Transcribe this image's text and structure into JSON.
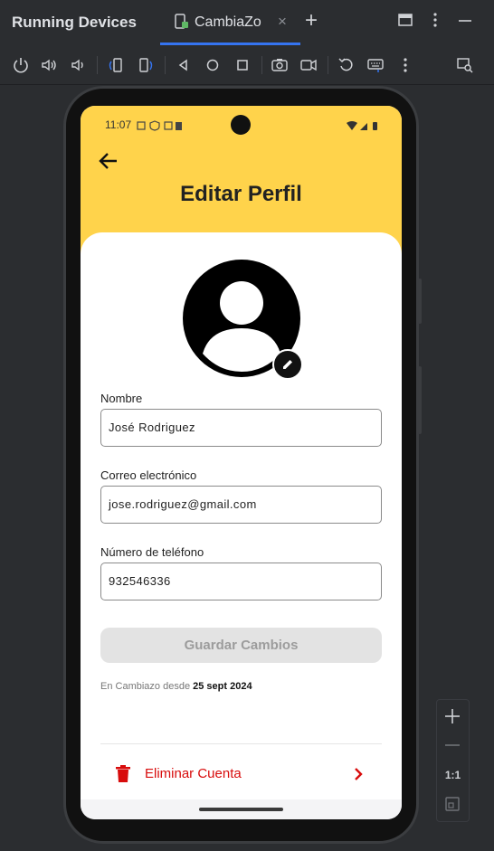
{
  "ide": {
    "panel_title": "Running Devices",
    "tab_label": "CambiaZo",
    "tab_close": "×",
    "add_tab": "+",
    "zoom_ratio": "1:1",
    "accent_color": "#3574f0"
  },
  "toolbar": {
    "icons": [
      "power-icon",
      "volume-up-icon",
      "volume-down-icon",
      "rotate-left-icon",
      "rotate-right-icon",
      "back-icon",
      "home-icon",
      "overview-icon",
      "screenshot-icon",
      "screen-record-icon",
      "reset-icon",
      "keyboard-icon",
      "more-icon",
      "device-explorer-icon"
    ]
  },
  "app": {
    "status_time": "11:07",
    "title": "Editar Perfil",
    "header_color": "#ffd34b",
    "fields": {
      "name_label": "Nombre",
      "name_value": "José Rodriguez",
      "email_label": "Correo electrónico",
      "email_value": "jose.rodriguez@gmail.com",
      "phone_label": "Número de  teléfono",
      "phone_value": "932546336"
    },
    "save_button": "Guardar Cambios",
    "since_prefix": "En Cambiazo desde ",
    "since_date": "25 sept 2024",
    "delete_label": "Eliminar Cuenta",
    "delete_color": "#d80c0c"
  }
}
